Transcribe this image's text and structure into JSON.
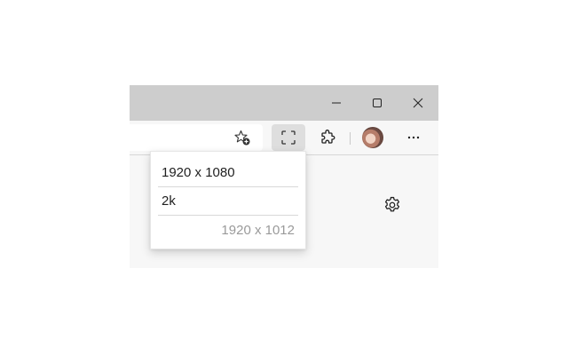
{
  "window_controls": {
    "minimize_icon": "minimize-icon",
    "maximize_icon": "maximize-icon",
    "close_icon": "close-icon"
  },
  "toolbar": {
    "favorites_icon": "add-favorite-star-icon",
    "fullscreen_icon": "fullscreen-icon",
    "extensions_icon": "puzzle-piece-icon",
    "profile_icon": "avatar",
    "more_icon": "ellipsis-icon"
  },
  "resolution_menu": {
    "options": [
      "1920 x 1080",
      "2k"
    ],
    "current_resolution": "1920 x 1012"
  },
  "content": {
    "settings_icon": "gear-icon"
  },
  "colors": {
    "titlebar": "#cdcdcd",
    "toolbar": "#f7f7f7",
    "active_button": "#dedede",
    "menu_text": "#1f1f1f",
    "muted_text": "#9a9a9a"
  }
}
